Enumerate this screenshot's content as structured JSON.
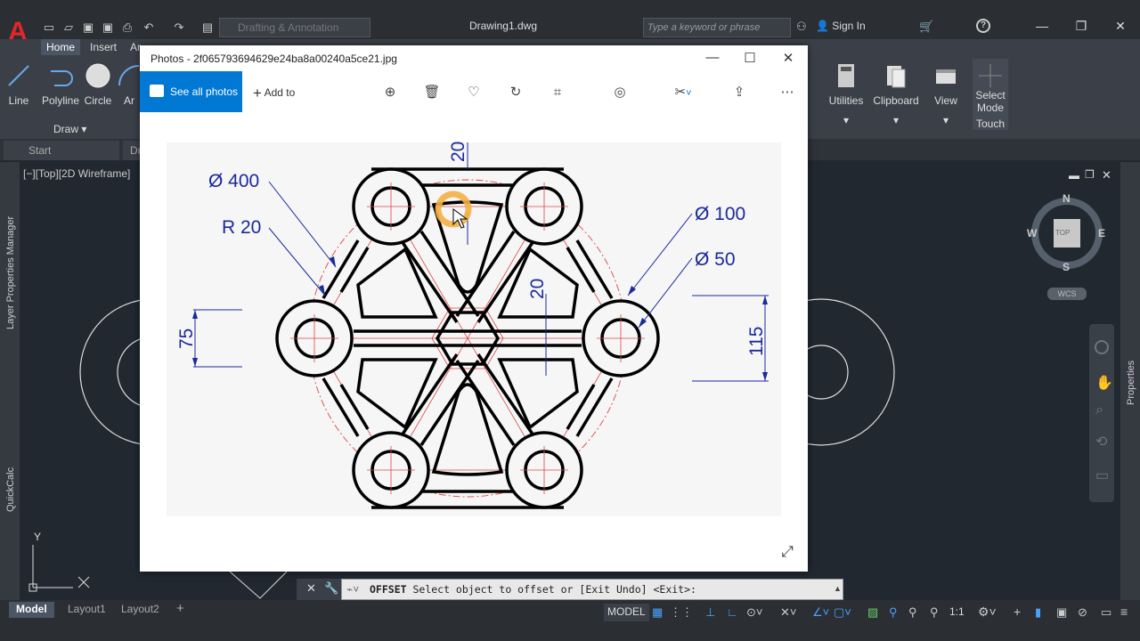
{
  "app": {
    "document_title": "Drawing1.dwg",
    "workspace": "Drafting & Annotation",
    "search_placeholder": "Type a keyword or phrase",
    "sign_in": "Sign In"
  },
  "ribbon": {
    "tabs": [
      "Home",
      "Insert",
      "Ar"
    ],
    "draw_tools": [
      "Line",
      "Polyline",
      "Circle",
      "Ar"
    ],
    "draw_panel": "Draw",
    "right_tools": [
      "Utilities",
      "Clipboard",
      "View"
    ],
    "select_mode": [
      "Select",
      "Mode"
    ],
    "touch": "Touch"
  },
  "file_tabs": [
    "Start",
    "Dr"
  ],
  "viewport": {
    "label": "[−][Top][2D Wireframe]",
    "compass": {
      "n": "N",
      "s": "S",
      "e": "E",
      "w": "W",
      "top": "TOP",
      "wcs": "WCS"
    },
    "axis_y": "Y"
  },
  "side_panels": {
    "left_top": "Layer Properties Manager",
    "left_bottom": "QuickCalc",
    "right": "Properties"
  },
  "photos": {
    "title": "Photos - 2f065793694629e24ba8a00240a5ce21.jpg",
    "see_all": "See all photos",
    "add_to": "Add to"
  },
  "drawing_labels": {
    "d400": "Ø 400",
    "r20": "R 20",
    "top20": "20",
    "mid20": "20",
    "d100": "Ø 100",
    "d50": "Ø 50",
    "v75": "75",
    "v115": "115"
  },
  "command": {
    "name": "OFFSET",
    "text": " Select object to offset or [Exit Undo] <Exit>:"
  },
  "layout_tabs": [
    "Model",
    "Layout1",
    "Layout2"
  ],
  "status": {
    "model": "MODEL",
    "scale": "1:1"
  }
}
